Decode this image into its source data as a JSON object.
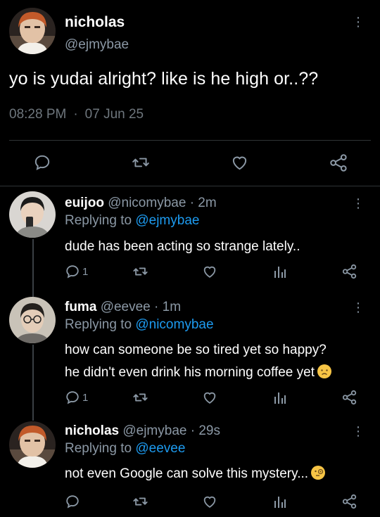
{
  "main": {
    "name": "nicholas",
    "handle": "@ejmybae",
    "text": "yo is yudai alright? like is he high or..??",
    "time": "08:28 PM",
    "date": "07 Jun 25"
  },
  "replies": [
    {
      "name": "euijoo",
      "handle": "@nicomybae",
      "age": "2m",
      "replying_prefix": "Replying to",
      "replying_to": "@ejmybae",
      "text": "dude has been acting so strange lately..",
      "reply_count": "1"
    },
    {
      "name": "fuma",
      "handle": "@eevee",
      "age": "1m",
      "replying_prefix": "Replying to",
      "replying_to": "@nicomybae",
      "text_line1": "how can someone be so tired yet so happy?",
      "text_line2": "he didn't even drink his morning coffee yet",
      "reply_count": "1",
      "emoji": "worried-face"
    },
    {
      "name": "nicholas",
      "handle": "@ejmybae",
      "age": "29s",
      "replying_prefix": "Replying to",
      "replying_to": "@eevee",
      "text": "not even Google can solve this mystery...",
      "emoji": "face-with-monocle"
    }
  ],
  "separator": "·",
  "icons": [
    "kebab-icon",
    "reply-icon",
    "retweet-icon",
    "like-icon",
    "share-icon",
    "analytics-icon"
  ],
  "colors": {
    "background": "#000000",
    "link": "#1d9bf0",
    "muted": "#8b98a5"
  }
}
